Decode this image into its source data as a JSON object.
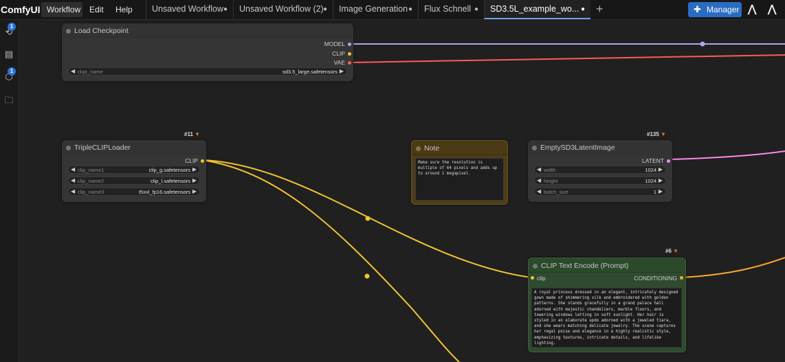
{
  "app": {
    "logo": "ComfyUI"
  },
  "menu": [
    "Workflow",
    "Edit",
    "Help"
  ],
  "tabs": [
    {
      "label": "Unsaved Workflow"
    },
    {
      "label": "Unsaved Workflow (2)"
    },
    {
      "label": "Image Generation"
    },
    {
      "label": "Flux Schnell"
    },
    {
      "label": "SD3.5L_example_wo...",
      "active": true
    }
  ],
  "toolbar": {
    "manager_label": "Manager",
    "new_tab": "+"
  },
  "sidebar": {
    "badges": [
      "1",
      "1"
    ]
  },
  "nodes": {
    "load_checkpoint": {
      "title": "Load Checkpoint",
      "outputs": [
        "MODEL",
        "CLIP",
        "VAE"
      ],
      "widgets": [
        {
          "name": "ckpt_name",
          "value": "sd3.5_large.safetensors"
        }
      ]
    },
    "triple_clip": {
      "id": "#11",
      "title": "TripleCLIPLoader",
      "outputs": [
        "CLIP"
      ],
      "widgets": [
        {
          "name": "clip_name1",
          "value": "clip_g.safetensors"
        },
        {
          "name": "clip_name2",
          "value": "clip_l.safetensors"
        },
        {
          "name": "clip_name3",
          "value": "t5xxl_fp16.safetensors"
        }
      ]
    },
    "note": {
      "title": "Note",
      "text": "Make sure the resolution is multiple of 64 pixels and adds up to around 1 megapixel."
    },
    "empty_latent": {
      "id": "#135",
      "title": "EmptySD3LatentImage",
      "outputs": [
        "LATENT"
      ],
      "widgets": [
        {
          "name": "width",
          "value": "1024"
        },
        {
          "name": "height",
          "value": "1024"
        },
        {
          "name": "batch_size",
          "value": "1"
        }
      ]
    },
    "clip_text_encode": {
      "id": "#6",
      "title": "CLIP Text Encode (Prompt)",
      "input": "clip",
      "output": "CONDITIONING",
      "prompt": "A royal princess dressed in an elegant, intricately designed gown made of shimmering silk and embroidered with golden patterns. She stands gracefully in a grand palace hall adorned with majestic chandeliers, marble floors, and towering windows letting in soft sunlight. Her hair is styled in an elaborate updo adorned with a jeweled tiara, and she wears matching delicate jewelry. The scene captures her regal poise and elegance in a highly realistic style, emphasizing textures, intricate details, and lifelike lighting."
    }
  },
  "colors": {
    "model": "#b4a4e8",
    "clip": "#f2c531",
    "vae": "#ff5b5b",
    "latent": "#ff8ae6",
    "conditioning": "#ffa931",
    "accent": "#2a6cc2"
  }
}
